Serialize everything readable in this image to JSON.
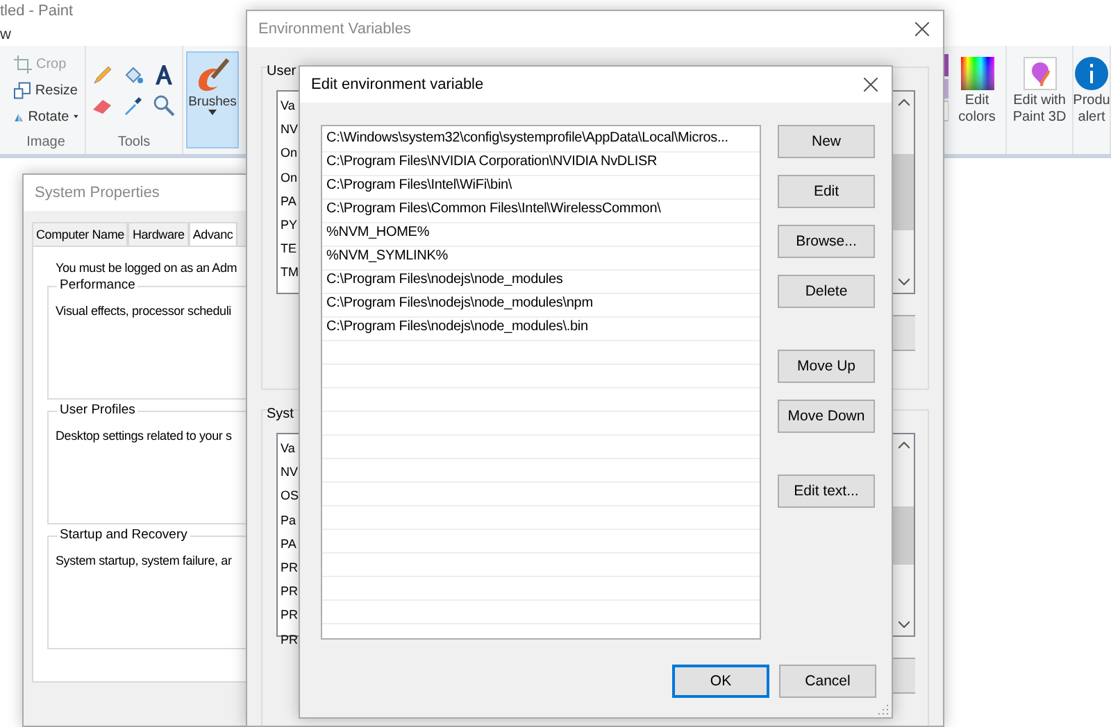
{
  "paint": {
    "title": "tled - Paint",
    "menu": [
      "w"
    ],
    "image_group": {
      "label": "Image",
      "items": [
        {
          "kind": "crop",
          "label": "Crop",
          "disabled": true
        },
        {
          "kind": "resize",
          "label": "Resize",
          "disabled": false
        },
        {
          "kind": "rotate",
          "label": "Rotate",
          "disabled": false
        }
      ]
    },
    "tools_group": {
      "label": "Tools"
    },
    "brushes": {
      "label": "Brushes",
      "selected": true
    },
    "right_items": [
      {
        "kind": "colors",
        "lines": [
          "Edit",
          "colors"
        ]
      },
      {
        "kind": "paint3d",
        "lines": [
          "Edit with",
          "Paint 3D"
        ]
      },
      {
        "kind": "info",
        "lines": [
          "Produ",
          "alert"
        ]
      }
    ]
  },
  "system_properties": {
    "title": "System Properties",
    "tabs": [
      {
        "label": "Computer Name",
        "selected": false
      },
      {
        "label": "Hardware",
        "selected": false
      },
      {
        "label": "Advanc",
        "selected": true
      }
    ],
    "notice": "You must be logged on as an Adm",
    "groups": [
      {
        "title": "Performance",
        "text": "Visual effects, processor scheduli"
      },
      {
        "title": "User Profiles",
        "text": "Desktop settings related to your s"
      },
      {
        "title": "Startup and Recovery",
        "text": "System startup, system failure, ar"
      }
    ]
  },
  "environment_variables": {
    "title": "Environment Variables",
    "sections": [
      {
        "label": "User",
        "rows": [
          "Va",
          "NV",
          "On",
          "On",
          "PA",
          "PY",
          "TE",
          "TM"
        ]
      },
      {
        "label": "Syst",
        "rows": [
          "Va",
          "NV",
          "OS",
          "Pa",
          "PA",
          "PR",
          "PR",
          "PR",
          "PR"
        ]
      }
    ]
  },
  "edit_dialog": {
    "title": "Edit environment variable",
    "entries": [
      "C:\\Windows\\system32\\config\\systemprofile\\AppData\\Local\\Micros...",
      "C:\\Program Files\\NVIDIA Corporation\\NVIDIA NvDLISR",
      "C:\\Program Files\\Intel\\WiFi\\bin\\",
      "C:\\Program Files\\Common Files\\Intel\\WirelessCommon\\",
      "%NVM_HOME%",
      "%NVM_SYMLINK%",
      "C:\\Program Files\\nodejs\\node_modules",
      "C:\\Program Files\\nodejs\\node_modules\\npm",
      "C:\\Program Files\\nodejs\\node_modules\\.bin"
    ],
    "side_button_groups": [
      [
        "New",
        "Edit",
        "Browse...",
        "Delete"
      ],
      [
        "Move Up",
        "Move Down"
      ],
      [
        "Edit text..."
      ]
    ],
    "footer_buttons": [
      {
        "label": "OK",
        "focused": true
      },
      {
        "label": "Cancel",
        "focused": false
      }
    ]
  }
}
